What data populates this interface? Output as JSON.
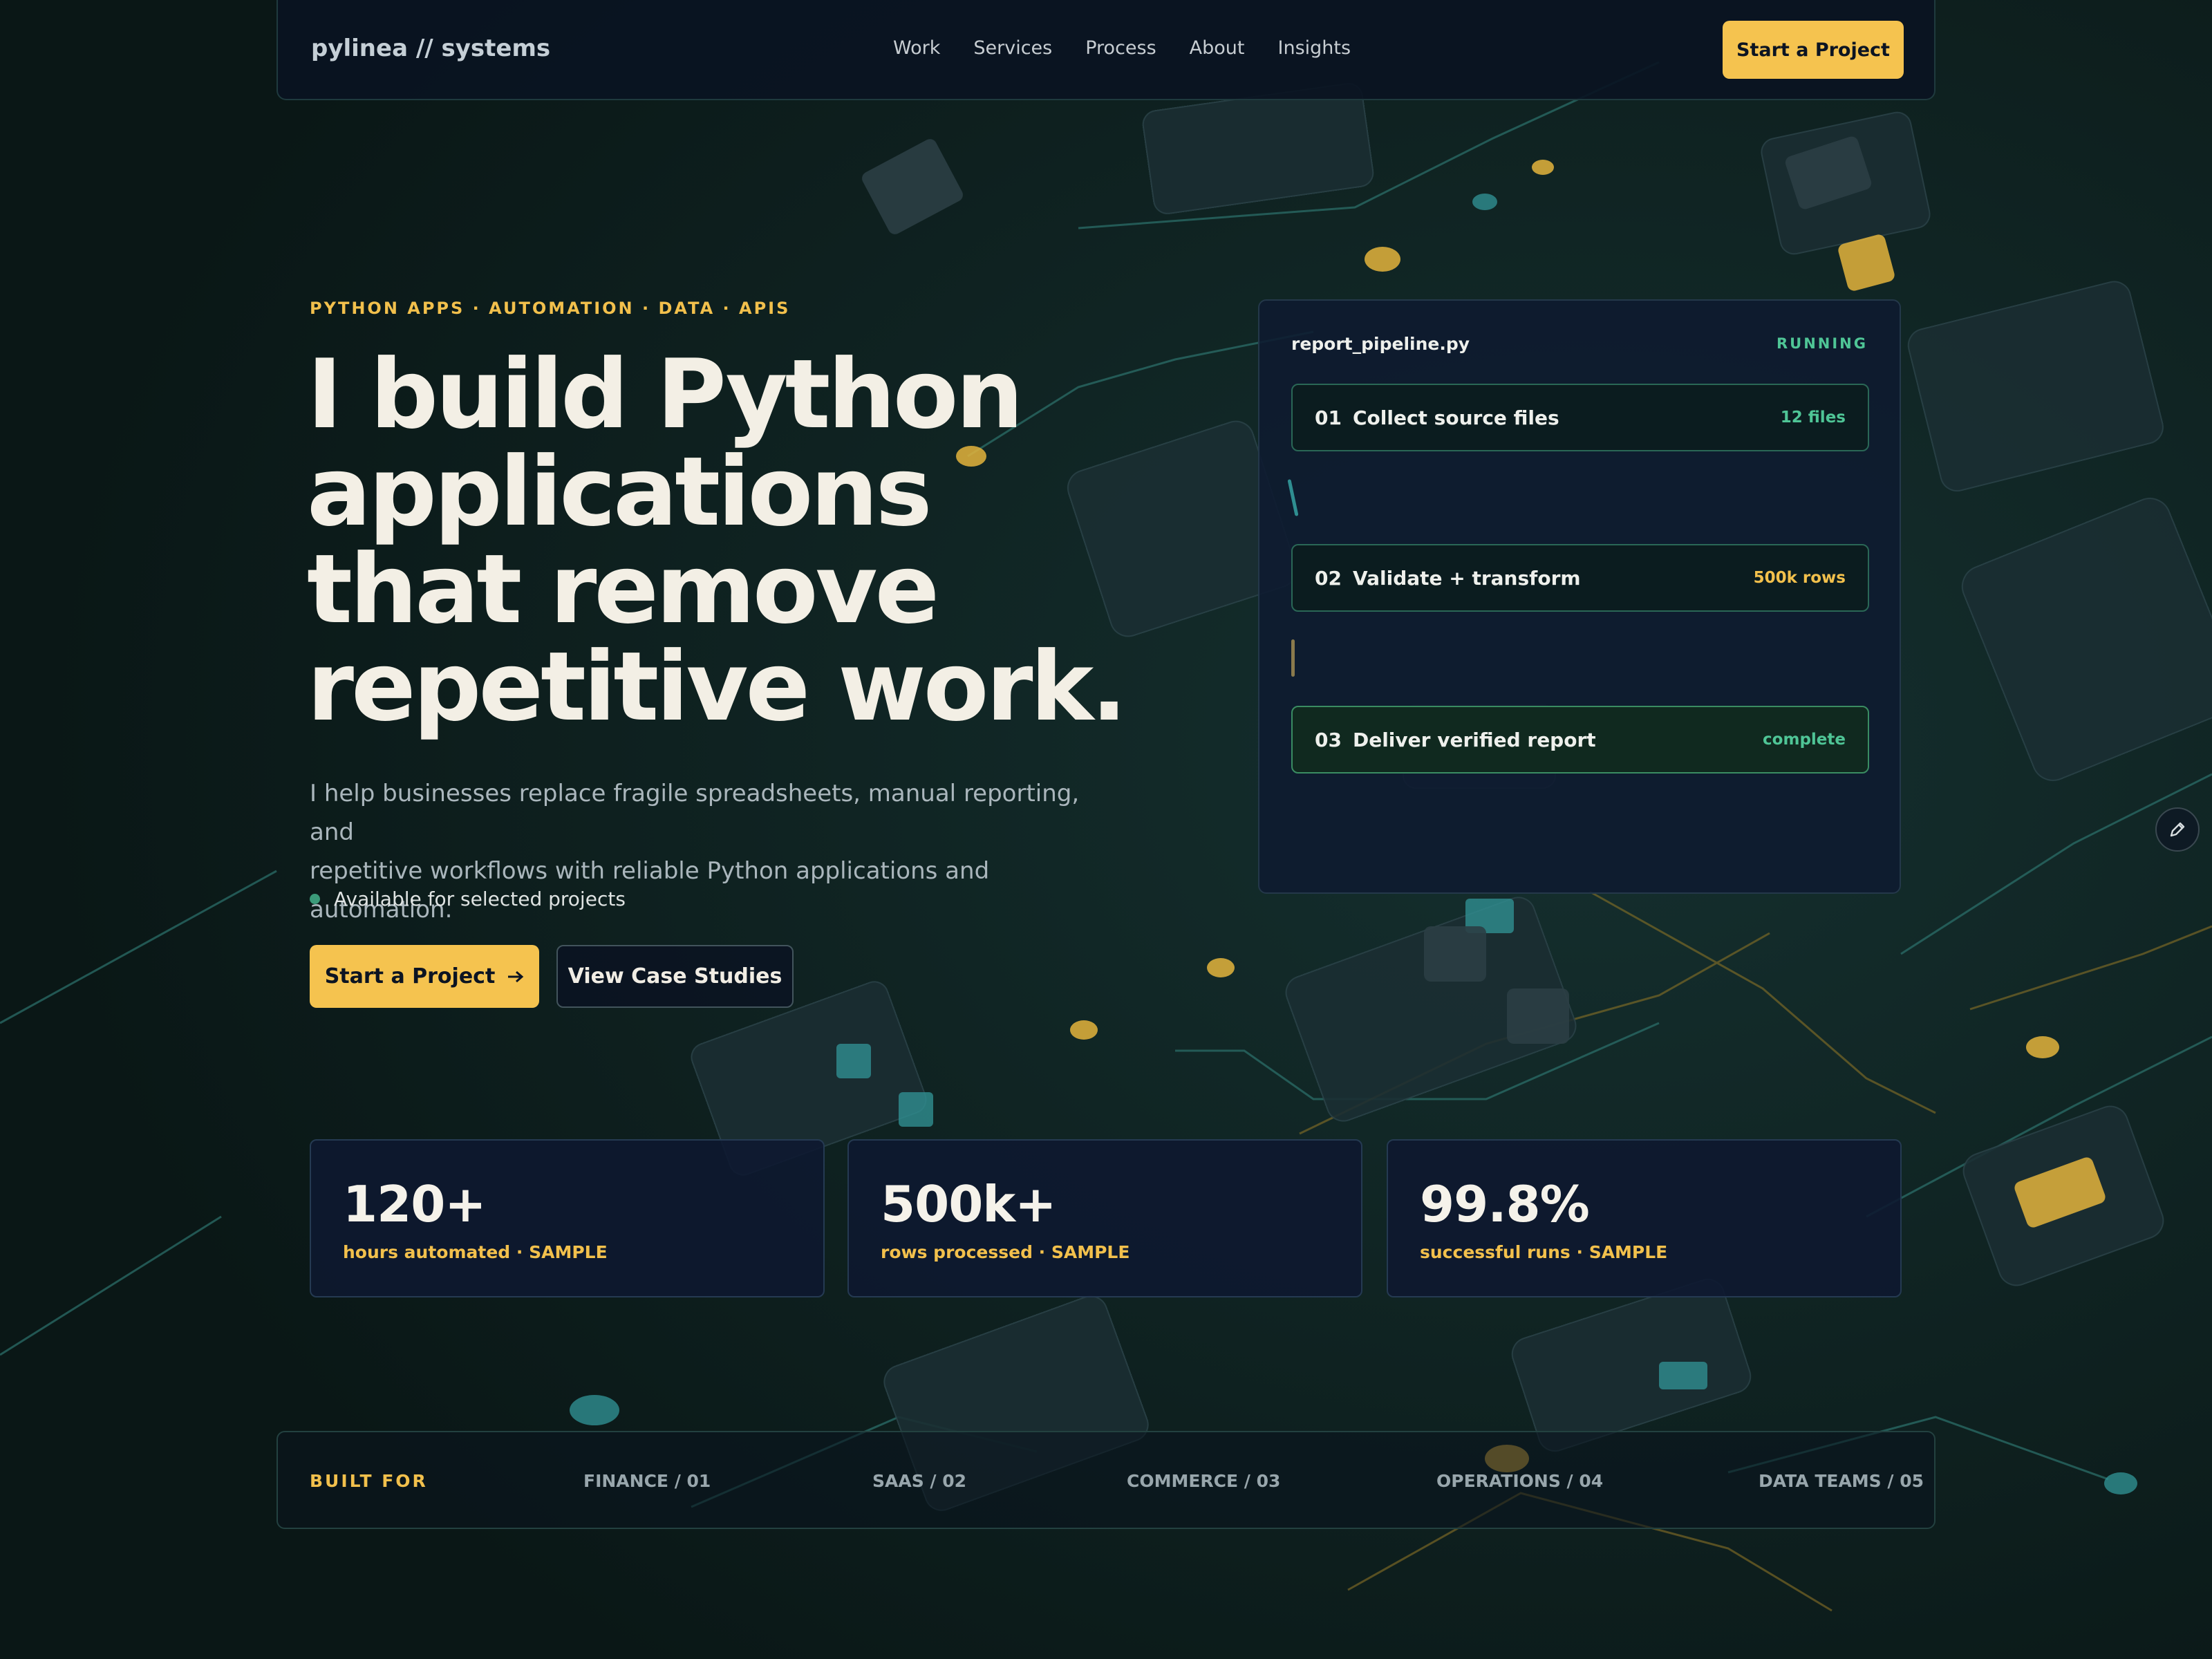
{
  "colors": {
    "accent": "#f5c34f",
    "status_green": "#4fc596",
    "background": "#0c1a1a",
    "panel": "#0e1a30"
  },
  "nav": {
    "logo": "pylinea // systems",
    "links": [
      "Work",
      "Services",
      "Process",
      "About",
      "Insights"
    ],
    "cta": "Start a Project"
  },
  "hero": {
    "eyebrow": "PYTHON APPS · AUTOMATION · DATA · APIS",
    "headline_lines": [
      "I build Python",
      "applications",
      "that remove",
      "repetitive work."
    ],
    "lede_lines": [
      "I help businesses replace fragile spreadsheets, manual reporting, and",
      "repetitive workflows with reliable Python applications and automation."
    ],
    "availability": "Available for selected projects",
    "primary_cta": "Start a Project",
    "primary_cta_icon": "arrow-right-icon",
    "secondary_cta": "View Case Studies"
  },
  "pipeline": {
    "filename": "report_pipeline.py",
    "status": "RUNNING",
    "steps": [
      {
        "num": "01",
        "label": "Collect source files",
        "meta": "12 files",
        "meta_color": "#4fc596"
      },
      {
        "num": "02",
        "label": "Validate + transform",
        "meta": "500k rows",
        "meta_color": "#f2c04c"
      },
      {
        "num": "03",
        "label": "Deliver verified report",
        "meta": "complete",
        "meta_color": "#4fc596"
      }
    ]
  },
  "stats": [
    {
      "value": "120+",
      "label": "hours automated · SAMPLE"
    },
    {
      "value": "500k+",
      "label": "rows processed · SAMPLE"
    },
    {
      "value": "99.8%",
      "label": "successful runs · SAMPLE"
    }
  ],
  "built_for": {
    "label": "BUILT FOR",
    "items": [
      "FINANCE / 01",
      "SAAS / 02",
      "COMMERCE / 03",
      "OPERATIONS / 04",
      "DATA TEAMS / 05"
    ]
  },
  "edit_icon": "pencil-icon"
}
